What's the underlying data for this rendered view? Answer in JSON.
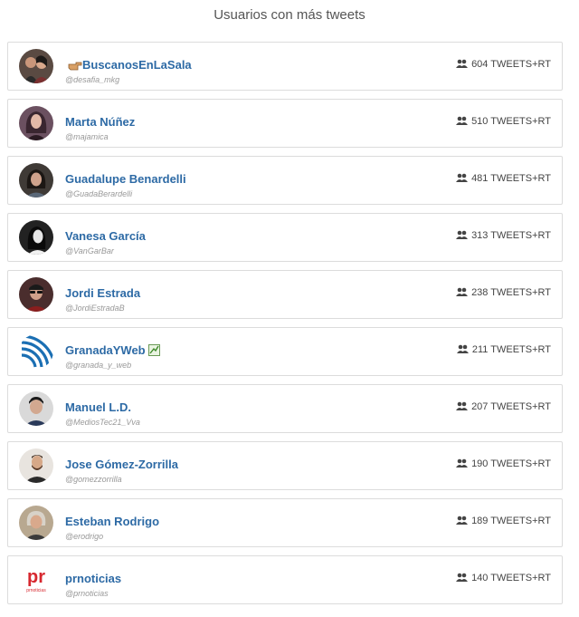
{
  "header": {
    "title": "Usuarios con más tweets"
  },
  "users": [
    {
      "name": "BuscanosEnLaSala",
      "prefix_icon": "pointing-hand-icon",
      "handle": "@desafia_mkg",
      "count": "604 TWEETS+RT",
      "avatar_icon": "couple-photo-icon",
      "avatar_bg": "#5a4a42"
    },
    {
      "name": "Marta Núñez",
      "handle": "@majamica",
      "count": "510 TWEETS+RT",
      "avatar_icon": "woman-photo-icon",
      "avatar_bg": "#6b5060"
    },
    {
      "name": "Guadalupe Benardelli",
      "handle": "@GuadaBerardelli",
      "count": "481 TWEETS+RT",
      "avatar_icon": "woman-photo-icon",
      "avatar_bg": "#3f3a36"
    },
    {
      "name": "Vanesa García",
      "handle": "@VanGarBar",
      "count": "313 TWEETS+RT",
      "avatar_icon": "woman-bw-photo-icon",
      "avatar_bg": "#222222"
    },
    {
      "name": "Jordi Estrada",
      "handle": "@JordiEstradaB",
      "count": "238 TWEETS+RT",
      "avatar_icon": "man-sunglasses-photo-icon",
      "avatar_bg": "#4a2d2d"
    },
    {
      "name": "GranadaYWeb",
      "suffix_icon": "check-box-icon",
      "handle": "@granada_y_web",
      "count": "211 TWEETS+RT",
      "avatar_icon": "wifi-logo-icon",
      "avatar_bg": "#ffffff"
    },
    {
      "name": "Manuel L.D.",
      "handle": "@MediosTec21_Vva",
      "count": "207 TWEETS+RT",
      "avatar_icon": "man-photo-icon",
      "avatar_bg": "#d9d9d9"
    },
    {
      "name": "Jose Gómez-Zorrilla",
      "handle": "@gomezzorrilla",
      "count": "190 TWEETS+RT",
      "avatar_icon": "man-beard-photo-icon",
      "avatar_bg": "#e8e4df"
    },
    {
      "name": "Esteban Rodrigo",
      "handle": "@erodrigo",
      "count": "189 TWEETS+RT",
      "avatar_icon": "man-gray-photo-icon",
      "avatar_bg": "#b8a890"
    },
    {
      "name": "prnoticias",
      "handle": "@prnoticias",
      "count": "140 TWEETS+RT",
      "avatar_icon": "prnoticias-logo-icon",
      "avatar_bg": "#ffffff",
      "logo_big": "pr",
      "logo_small": "prnoticias"
    }
  ],
  "colors": {
    "name_link": "#2d6aa5",
    "handle": "#999999",
    "border": "#dcdcdc",
    "logo_red": "#d7282f",
    "logo_blue": "#1b6fb3"
  }
}
